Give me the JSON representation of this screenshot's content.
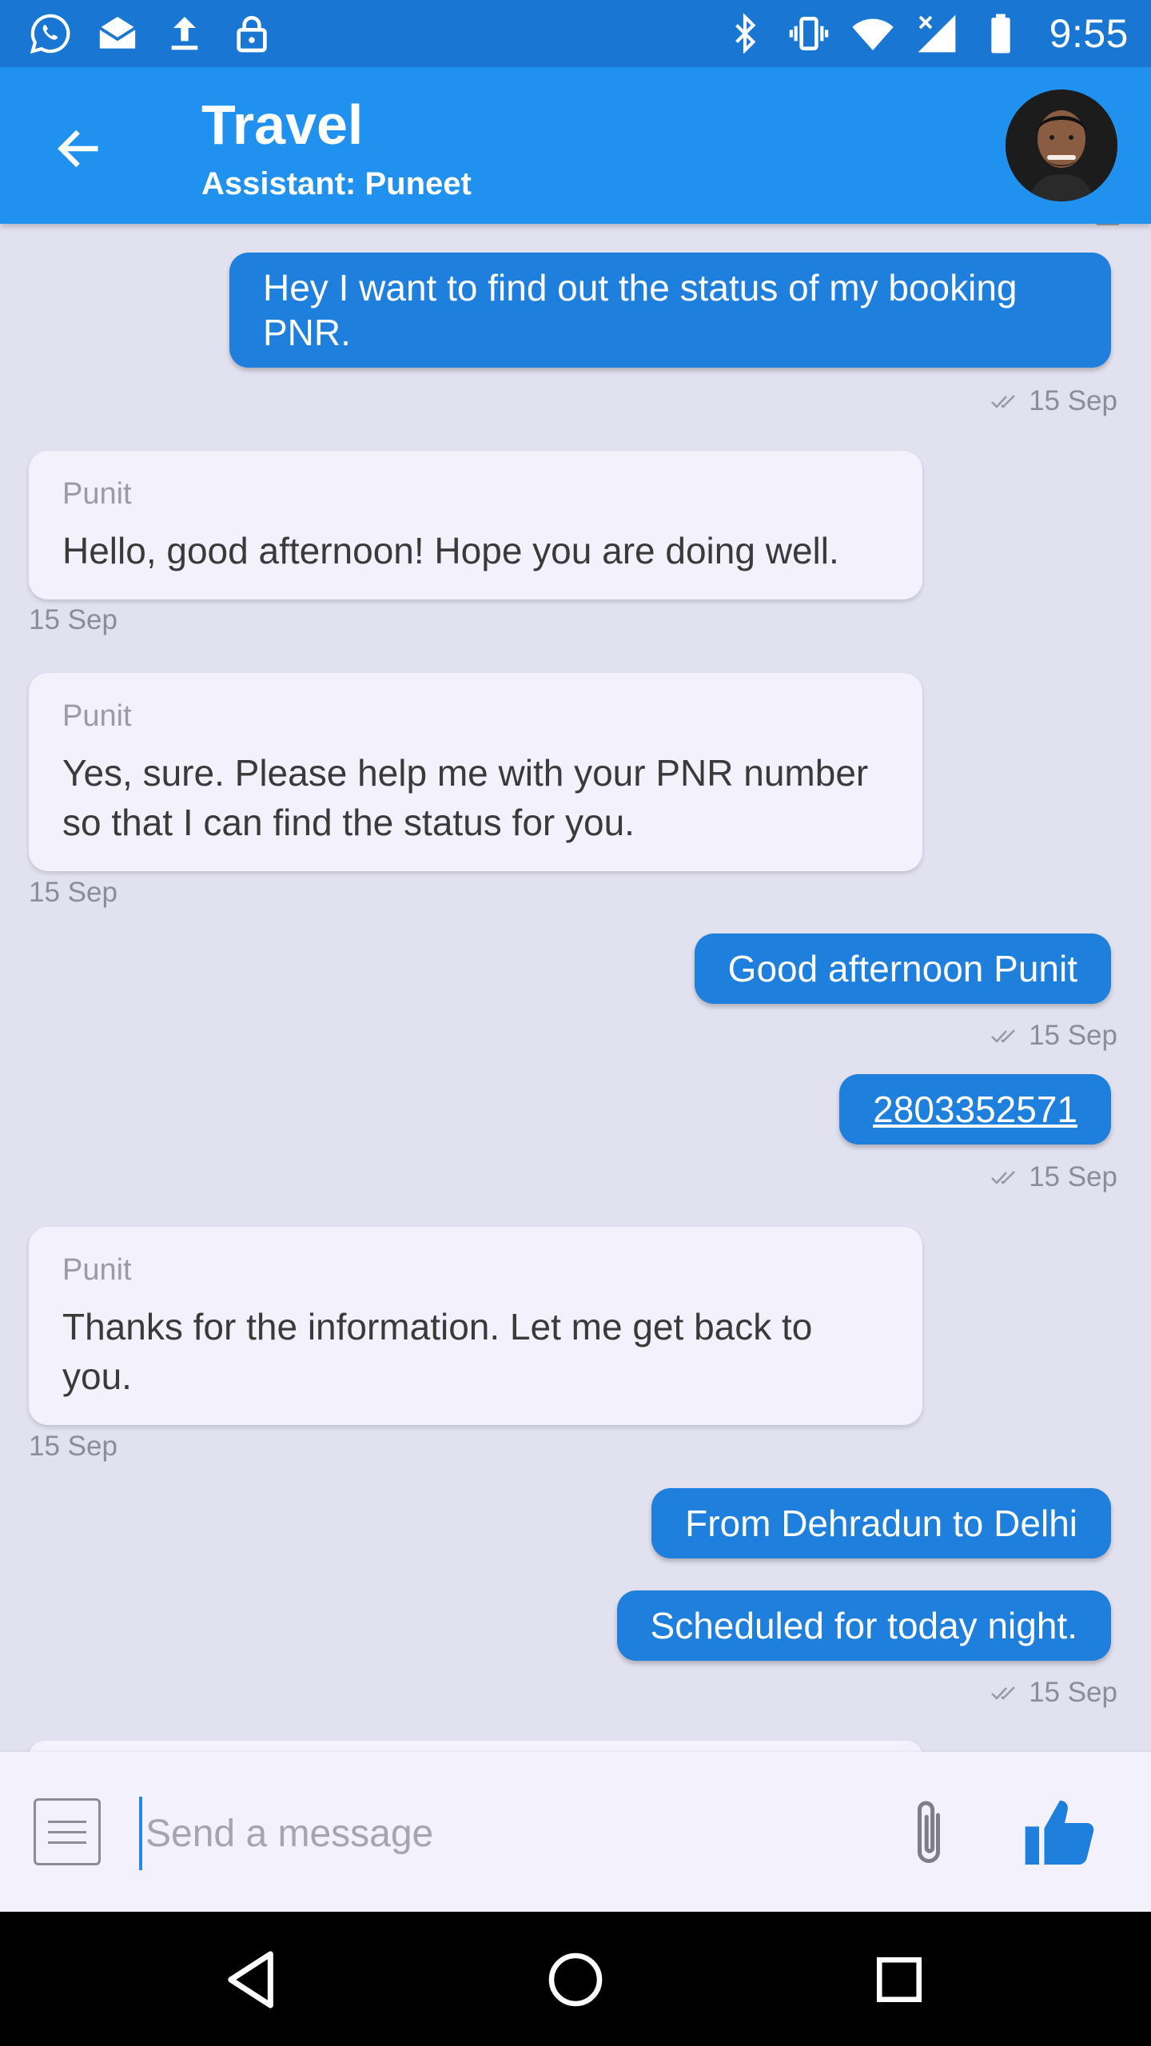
{
  "status_bar": {
    "time": "9:55",
    "left_icons": [
      "whatsapp-icon",
      "mail-icon",
      "upload-icon",
      "lock-icon"
    ],
    "right_icons": [
      "bluetooth-icon",
      "vibrate-icon",
      "wifi-icon",
      "signal-icon",
      "battery-icon"
    ]
  },
  "header": {
    "title": "Travel",
    "subtitle": "Assistant: Puneet"
  },
  "messages": [
    {
      "direction": "out",
      "text": "Hey I want to find out the status of my booking PNR.",
      "time": "15 Sep"
    },
    {
      "direction": "in",
      "sender": "Punit",
      "text": "Hello, good afternoon! Hope you are doing well.",
      "time": "15 Sep"
    },
    {
      "direction": "in",
      "sender": "Punit",
      "text": "Yes, sure. Please help me with your PNR number so that I can find the status for you.",
      "time": "15 Sep"
    },
    {
      "direction": "out",
      "text": "Good afternoon Punit",
      "time": "15 Sep"
    },
    {
      "direction": "out",
      "text": "2803352571",
      "time": "15 Sep"
    },
    {
      "direction": "in",
      "sender": "Punit",
      "text": "Thanks for the information. Let me get back to you.",
      "time": "15 Sep"
    },
    {
      "direction": "out",
      "text": "From Dehradun to Delhi"
    },
    {
      "direction": "out",
      "text": "Scheduled for today night.",
      "time": "15 Sep"
    }
  ],
  "composer": {
    "placeholder": "Send a message"
  },
  "colors": {
    "status_bar": "#1976d2",
    "app_bar": "#2191f0",
    "outgoing_bubble": "#1e7fdc",
    "incoming_bubble": "#f2f1fc",
    "chat_background": "#e2e1ef"
  }
}
